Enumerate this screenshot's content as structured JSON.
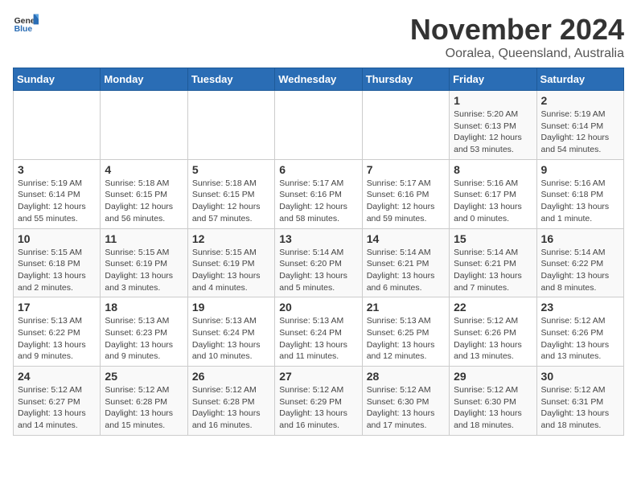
{
  "logo": {
    "text_general": "General",
    "text_blue": "Blue"
  },
  "header": {
    "month_title": "November 2024",
    "location": "Ooralea, Queensland, Australia"
  },
  "days_of_week": [
    "Sunday",
    "Monday",
    "Tuesday",
    "Wednesday",
    "Thursday",
    "Friday",
    "Saturday"
  ],
  "weeks": [
    [
      {
        "day": "",
        "info": ""
      },
      {
        "day": "",
        "info": ""
      },
      {
        "day": "",
        "info": ""
      },
      {
        "day": "",
        "info": ""
      },
      {
        "day": "",
        "info": ""
      },
      {
        "day": "1",
        "info": "Sunrise: 5:20 AM\nSunset: 6:13 PM\nDaylight: 12 hours\nand 53 minutes."
      },
      {
        "day": "2",
        "info": "Sunrise: 5:19 AM\nSunset: 6:14 PM\nDaylight: 12 hours\nand 54 minutes."
      }
    ],
    [
      {
        "day": "3",
        "info": "Sunrise: 5:19 AM\nSunset: 6:14 PM\nDaylight: 12 hours\nand 55 minutes."
      },
      {
        "day": "4",
        "info": "Sunrise: 5:18 AM\nSunset: 6:15 PM\nDaylight: 12 hours\nand 56 minutes."
      },
      {
        "day": "5",
        "info": "Sunrise: 5:18 AM\nSunset: 6:15 PM\nDaylight: 12 hours\nand 57 minutes."
      },
      {
        "day": "6",
        "info": "Sunrise: 5:17 AM\nSunset: 6:16 PM\nDaylight: 12 hours\nand 58 minutes."
      },
      {
        "day": "7",
        "info": "Sunrise: 5:17 AM\nSunset: 6:16 PM\nDaylight: 12 hours\nand 59 minutes."
      },
      {
        "day": "8",
        "info": "Sunrise: 5:16 AM\nSunset: 6:17 PM\nDaylight: 13 hours\nand 0 minutes."
      },
      {
        "day": "9",
        "info": "Sunrise: 5:16 AM\nSunset: 6:18 PM\nDaylight: 13 hours\nand 1 minute."
      }
    ],
    [
      {
        "day": "10",
        "info": "Sunrise: 5:15 AM\nSunset: 6:18 PM\nDaylight: 13 hours\nand 2 minutes."
      },
      {
        "day": "11",
        "info": "Sunrise: 5:15 AM\nSunset: 6:19 PM\nDaylight: 13 hours\nand 3 minutes."
      },
      {
        "day": "12",
        "info": "Sunrise: 5:15 AM\nSunset: 6:19 PM\nDaylight: 13 hours\nand 4 minutes."
      },
      {
        "day": "13",
        "info": "Sunrise: 5:14 AM\nSunset: 6:20 PM\nDaylight: 13 hours\nand 5 minutes."
      },
      {
        "day": "14",
        "info": "Sunrise: 5:14 AM\nSunset: 6:21 PM\nDaylight: 13 hours\nand 6 minutes."
      },
      {
        "day": "15",
        "info": "Sunrise: 5:14 AM\nSunset: 6:21 PM\nDaylight: 13 hours\nand 7 minutes."
      },
      {
        "day": "16",
        "info": "Sunrise: 5:14 AM\nSunset: 6:22 PM\nDaylight: 13 hours\nand 8 minutes."
      }
    ],
    [
      {
        "day": "17",
        "info": "Sunrise: 5:13 AM\nSunset: 6:22 PM\nDaylight: 13 hours\nand 9 minutes."
      },
      {
        "day": "18",
        "info": "Sunrise: 5:13 AM\nSunset: 6:23 PM\nDaylight: 13 hours\nand 9 minutes."
      },
      {
        "day": "19",
        "info": "Sunrise: 5:13 AM\nSunset: 6:24 PM\nDaylight: 13 hours\nand 10 minutes."
      },
      {
        "day": "20",
        "info": "Sunrise: 5:13 AM\nSunset: 6:24 PM\nDaylight: 13 hours\nand 11 minutes."
      },
      {
        "day": "21",
        "info": "Sunrise: 5:13 AM\nSunset: 6:25 PM\nDaylight: 13 hours\nand 12 minutes."
      },
      {
        "day": "22",
        "info": "Sunrise: 5:12 AM\nSunset: 6:26 PM\nDaylight: 13 hours\nand 13 minutes."
      },
      {
        "day": "23",
        "info": "Sunrise: 5:12 AM\nSunset: 6:26 PM\nDaylight: 13 hours\nand 13 minutes."
      }
    ],
    [
      {
        "day": "24",
        "info": "Sunrise: 5:12 AM\nSunset: 6:27 PM\nDaylight: 13 hours\nand 14 minutes."
      },
      {
        "day": "25",
        "info": "Sunrise: 5:12 AM\nSunset: 6:28 PM\nDaylight: 13 hours\nand 15 minutes."
      },
      {
        "day": "26",
        "info": "Sunrise: 5:12 AM\nSunset: 6:28 PM\nDaylight: 13 hours\nand 16 minutes."
      },
      {
        "day": "27",
        "info": "Sunrise: 5:12 AM\nSunset: 6:29 PM\nDaylight: 13 hours\nand 16 minutes."
      },
      {
        "day": "28",
        "info": "Sunrise: 5:12 AM\nSunset: 6:30 PM\nDaylight: 13 hours\nand 17 minutes."
      },
      {
        "day": "29",
        "info": "Sunrise: 5:12 AM\nSunset: 6:30 PM\nDaylight: 13 hours\nand 18 minutes."
      },
      {
        "day": "30",
        "info": "Sunrise: 5:12 AM\nSunset: 6:31 PM\nDaylight: 13 hours\nand 18 minutes."
      }
    ]
  ]
}
